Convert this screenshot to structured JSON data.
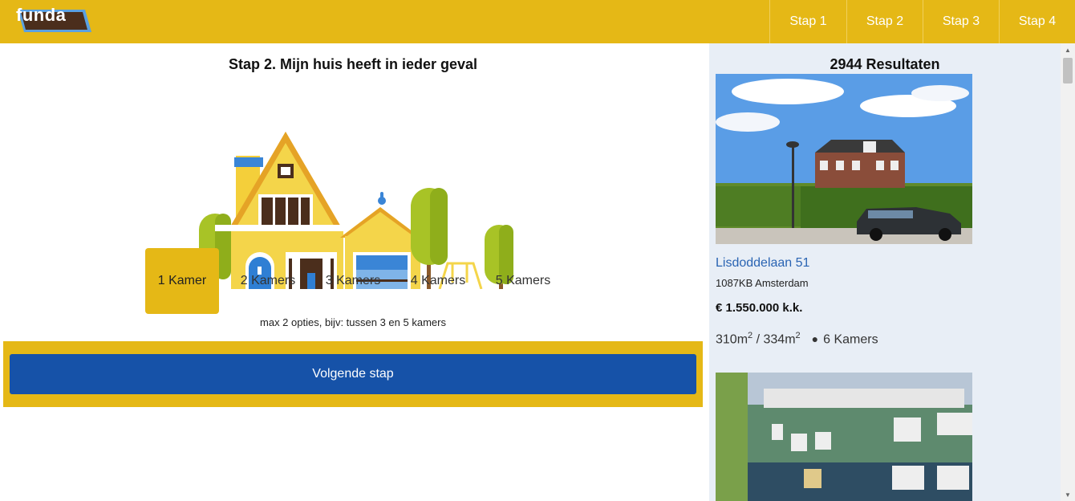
{
  "header": {
    "logo_text": "funda",
    "steps": [
      "Stap 1",
      "Stap 2",
      "Stap 3",
      "Stap 4"
    ]
  },
  "main": {
    "title": "Stap 2. Mijn huis heeft in ieder geval",
    "rooms": [
      "1 Kamer",
      "2 Kamers",
      "3 Kamers",
      "4 Kamers",
      "5 Kamers"
    ],
    "selected_room": "1 Kamer",
    "hint": "max 2 opties, bijv: tussen 3 en 5 kamers",
    "next_button": "Volgende stap"
  },
  "sidebar": {
    "results": "2944 Resultaten",
    "listing": {
      "address": "Lisdoddelaan 51",
      "city": "1087KB Amsterdam",
      "price": "€ 1.550.000 k.k.",
      "living_area": "310m",
      "plot_area": "334m",
      "area_sup": "2",
      "area_sep": " / ",
      "rooms": "6 Kamers"
    }
  },
  "colors": {
    "brand_yellow": "#e5b816",
    "button_blue": "#1652a8",
    "link_blue": "#2a64b3",
    "sidebar_bg": "#e8eef6"
  }
}
